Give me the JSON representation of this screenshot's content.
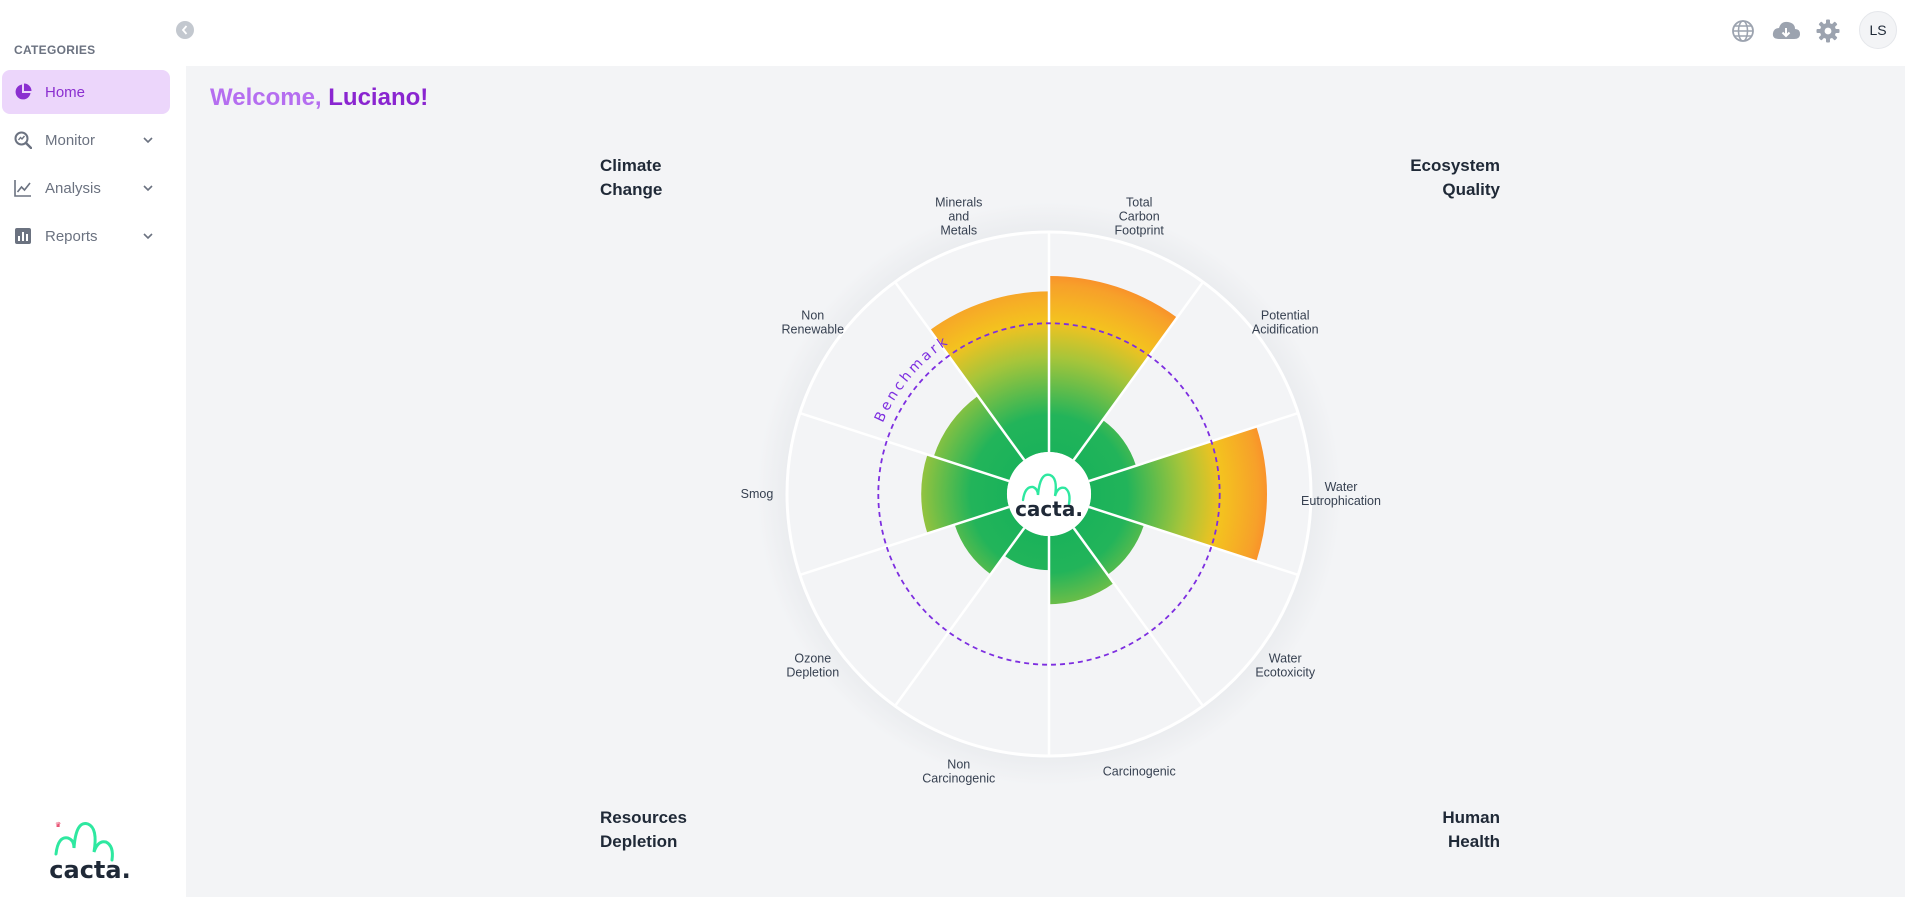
{
  "sidebar": {
    "categories_title": "CATEGORIES",
    "items": [
      {
        "label": "Home",
        "icon": "pie-chart-icon",
        "active": true
      },
      {
        "label": "Monitor",
        "icon": "magnify-chart-icon",
        "expandable": true
      },
      {
        "label": "Analysis",
        "icon": "line-chart-icon",
        "expandable": true
      },
      {
        "label": "Reports",
        "icon": "bar-chart-icon",
        "expandable": true
      }
    ],
    "logo_text": "cacta."
  },
  "header": {
    "icons": [
      "globe-icon",
      "cloud-download-icon",
      "gear-icon"
    ],
    "avatar_initials": "LS"
  },
  "main": {
    "welcome_prefix": "Welcome, ",
    "welcome_name": "Luciano!",
    "quadrants": {
      "climate": [
        "Climate",
        "Change"
      ],
      "ecosystem": [
        "Ecosystem",
        "Quality"
      ],
      "resources": [
        "Resources",
        "Depletion"
      ],
      "human": [
        "Human",
        "Health"
      ]
    }
  },
  "colors": {
    "accent": "#8a25d0",
    "accent_light": "#b56ef0",
    "active_bg": "#ecd6fb",
    "green": "#12b05a",
    "yellow": "#f4c21f",
    "orange": "#f58a1e",
    "red": "#ff4a2c",
    "benchmark": "#7d2ee0"
  },
  "chart_data": {
    "type": "polar-area",
    "center_logo": "cacta.",
    "benchmark_label": "Benchmark",
    "benchmark_value": 0.585,
    "scale_max": 1.0,
    "series": [
      {
        "label": [
          "Total",
          "Carbon",
          "Footprint"
        ],
        "value": 0.8
      },
      {
        "label": [
          "Potential",
          "Acidification"
        ],
        "value": 0.225
      },
      {
        "label": [
          "Water",
          "Eutrophication"
        ],
        "value": 0.8
      },
      {
        "label": [
          "Water",
          "Ecotoxicity"
        ],
        "value": 0.263
      },
      {
        "label": [
          "Carcinogenic"
        ],
        "value": 0.31
      },
      {
        "label": [
          "Non",
          "Carcinogenic"
        ],
        "value": 0.155
      },
      {
        "label": [
          "Ozone",
          "Depletion"
        ],
        "value": 0.26
      },
      {
        "label": [
          "Smog"
        ],
        "value": 0.39
      },
      {
        "label": [
          "Non",
          "Renewable"
        ],
        "value": 0.36
      },
      {
        "label": [
          "Minerals",
          "and",
          "Metals"
        ],
        "value": 0.73
      }
    ]
  }
}
